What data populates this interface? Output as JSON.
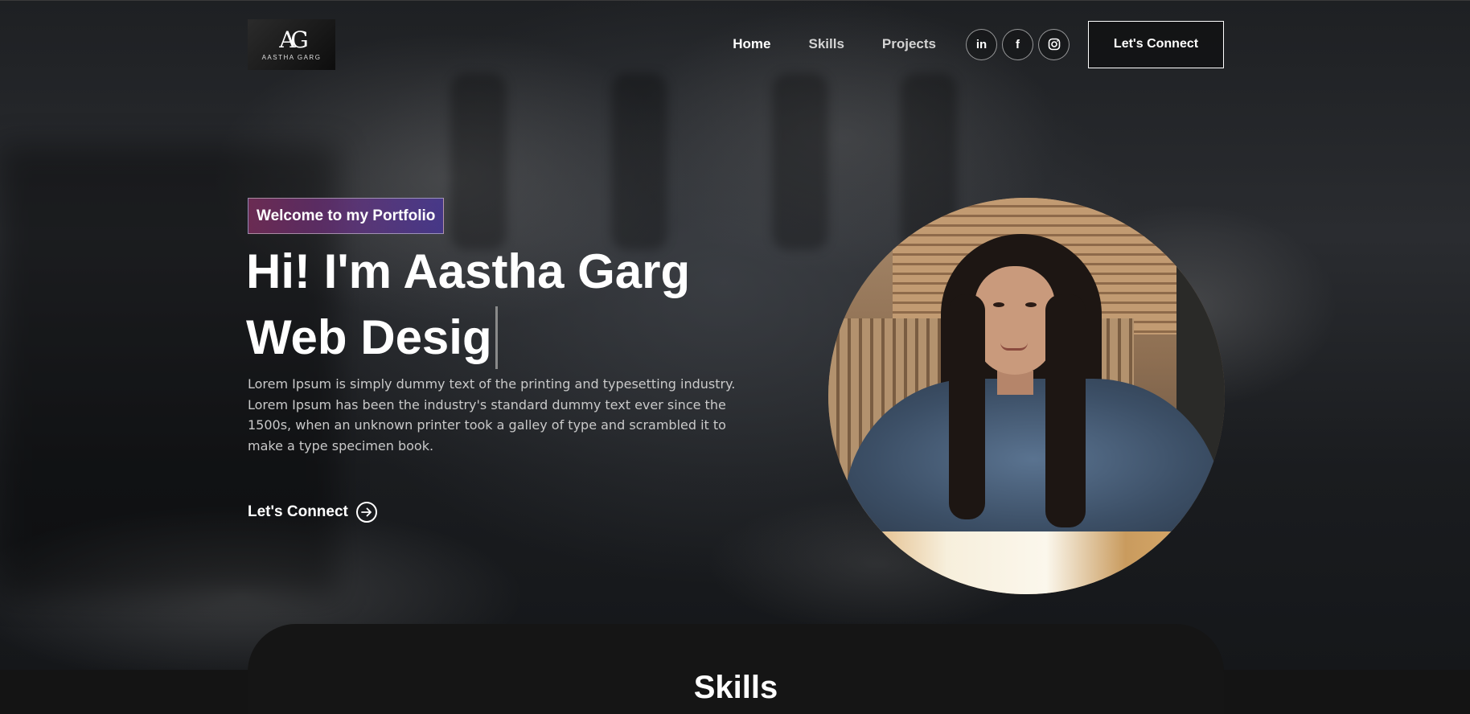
{
  "logo": {
    "mark": "AG",
    "text": "AASTHA GARG"
  },
  "nav": {
    "links": [
      "Home",
      "Skills",
      "Projects"
    ],
    "active": "Home",
    "socials": [
      {
        "icon": "linkedin-icon",
        "glyph": "in"
      },
      {
        "icon": "facebook-icon",
        "glyph": "f"
      },
      {
        "icon": "instagram-icon",
        "glyph": "◎"
      }
    ],
    "connect_label": "Let's Connect"
  },
  "hero": {
    "tagline": "Welcome to my Portfolio",
    "title": "Hi! I'm Aastha Garg",
    "role": "Web Desig",
    "description": "Lorem Ipsum is simply dummy text of the printing and typesetting industry. Lorem Ipsum has been the industry's standard dummy text ever since the 1500s, when an unknown printer took a galley of type and scrambled it to make a type specimen book.",
    "cta_label": "Let's Connect",
    "cta_icon": "arrow-right-circle-icon"
  },
  "skills": {
    "title": "Skills"
  },
  "colors": {
    "tagline_gradient_start": "#aa367c",
    "tagline_gradient_end": "#4a2fbd",
    "background": "#121212"
  }
}
